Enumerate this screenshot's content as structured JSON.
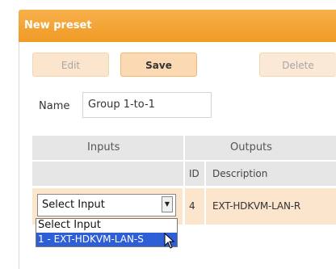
{
  "panel": {
    "title": "New preset",
    "accent_color": "#f09a25"
  },
  "toolbar": {
    "edit_label": "Edit",
    "save_label": "Save",
    "delete_label": "Delete"
  },
  "name_field": {
    "label": "Name",
    "value": "Group 1-to-1"
  },
  "table": {
    "inputs_header": "Inputs",
    "outputs_header": "Outputs",
    "id_header": "ID",
    "description_header": "Description",
    "rows": [
      {
        "input_selected": "Select Input",
        "output_id": "4",
        "output_description": "EXT-HDKVM-LAN-R"
      }
    ]
  },
  "dropdown": {
    "options": [
      "Select Input",
      "1 - EXT-HDKVM-LAN-S"
    ],
    "highlighted_index": 1
  },
  "icons": {
    "select_arrow": "chevron-down-icon",
    "cursor": "mouse-pointer-icon"
  }
}
